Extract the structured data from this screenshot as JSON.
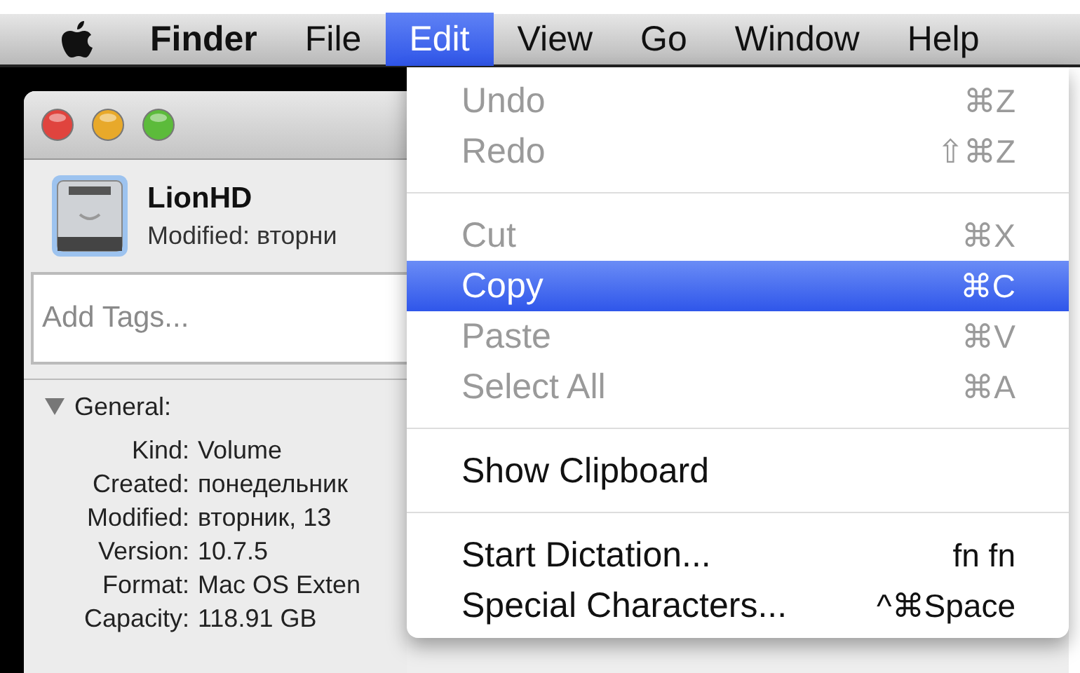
{
  "menubar": {
    "items": [
      {
        "label": "Finder",
        "selected": false,
        "bold": true
      },
      {
        "label": "File",
        "selected": false,
        "bold": false
      },
      {
        "label": "Edit",
        "selected": true,
        "bold": false
      },
      {
        "label": "View",
        "selected": false,
        "bold": false
      },
      {
        "label": "Go",
        "selected": false,
        "bold": false
      },
      {
        "label": "Window",
        "selected": false,
        "bold": false
      },
      {
        "label": "Help",
        "selected": false,
        "bold": false
      }
    ]
  },
  "info_window": {
    "name": "LionHD",
    "modified": "Modified: вторни",
    "tags": {
      "placeholder": "Add Tags..."
    },
    "section": {
      "title": "General:",
      "expanded": true
    },
    "rows": [
      {
        "label": "Kind:",
        "value": "Volume"
      },
      {
        "label": "Created:",
        "value": "понедельник"
      },
      {
        "label": "Modified:",
        "value": "вторник, 13"
      },
      {
        "label": "Version:",
        "value": "10.7.5"
      },
      {
        "label": "Format:",
        "value": "Mac OS Exten"
      },
      {
        "label": "Capacity:",
        "value": "118.91 GB"
      }
    ]
  },
  "edit_menu": {
    "items": [
      {
        "kind": "item",
        "label": "Undo",
        "shortcut": "⌘Z",
        "disabled": true,
        "selected": false
      },
      {
        "kind": "item",
        "label": "Redo",
        "shortcut": "⇧⌘Z",
        "disabled": true,
        "selected": false
      },
      {
        "kind": "separator"
      },
      {
        "kind": "item",
        "label": "Cut",
        "shortcut": "⌘X",
        "disabled": true,
        "selected": false
      },
      {
        "kind": "item",
        "label": "Copy",
        "shortcut": "⌘C",
        "disabled": false,
        "selected": true
      },
      {
        "kind": "item",
        "label": "Paste",
        "shortcut": "⌘V",
        "disabled": true,
        "selected": false
      },
      {
        "kind": "item",
        "label": "Select All",
        "shortcut": "⌘A",
        "disabled": true,
        "selected": false
      },
      {
        "kind": "separator"
      },
      {
        "kind": "item",
        "label": "Show Clipboard",
        "disabled": false,
        "selected": false
      },
      {
        "kind": "separator"
      },
      {
        "kind": "item",
        "label": "Start Dictation...",
        "shortcut": "fn fn",
        "disabled": false,
        "selected": false
      },
      {
        "kind": "item",
        "label": "Special Characters...",
        "shortcut": "^⌘Space",
        "disabled": false,
        "selected": false
      }
    ]
  }
}
